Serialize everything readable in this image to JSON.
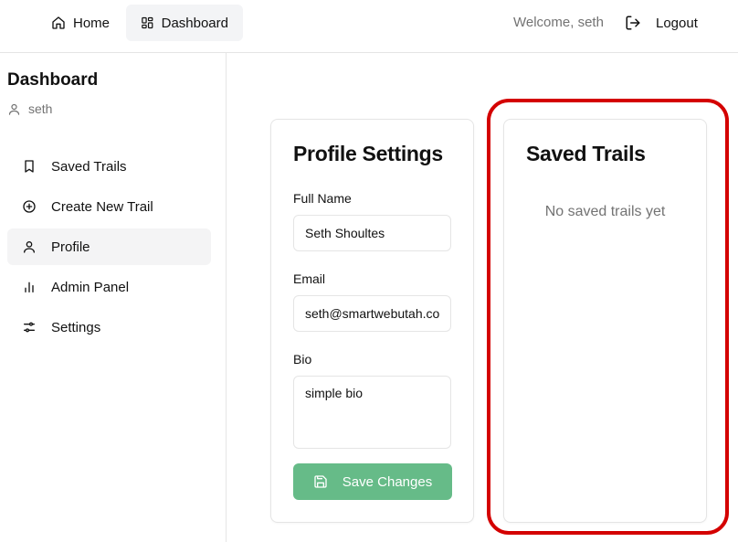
{
  "topbar": {
    "home_label": "Home",
    "dashboard_label": "Dashboard",
    "welcome_text": "Welcome, seth",
    "logout_label": "Logout"
  },
  "sidebar": {
    "title": "Dashboard",
    "username": "seth",
    "items": [
      {
        "label": "Saved Trails",
        "icon": "bookmark-icon"
      },
      {
        "label": "Create New Trail",
        "icon": "plus-circle-icon"
      },
      {
        "label": "Profile",
        "icon": "user-icon"
      },
      {
        "label": "Admin Panel",
        "icon": "bar-chart-icon"
      },
      {
        "label": "Settings",
        "icon": "sliders-icon"
      }
    ]
  },
  "profile": {
    "title": "Profile Settings",
    "full_name_label": "Full Name",
    "full_name_value": "Seth Shoultes",
    "email_label": "Email",
    "email_value": "seth@smartwebutah.com",
    "bio_label": "Bio",
    "bio_value": "simple bio",
    "save_label": "Save Changes"
  },
  "saved_trails": {
    "title": "Saved Trails",
    "empty_message": "No saved trails yet"
  },
  "colors": {
    "accent_green": "#66bb88",
    "active_bg": "#f4f4f5",
    "highlight_red": "#d40000"
  }
}
